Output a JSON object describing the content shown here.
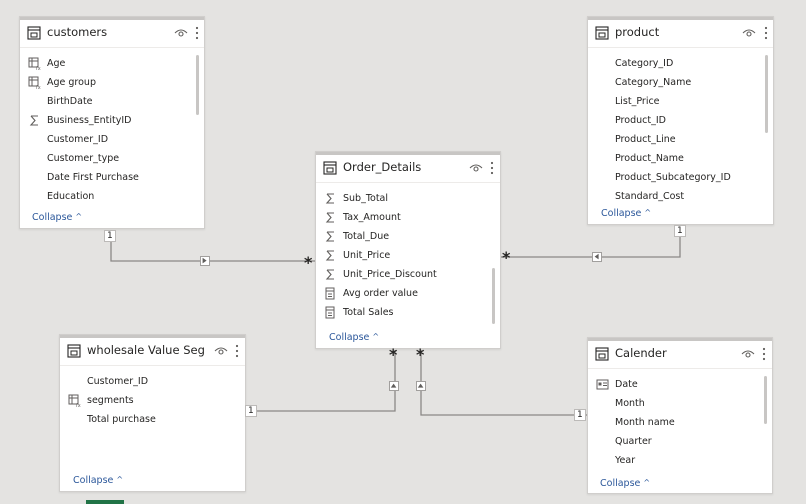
{
  "tables": {
    "customers": {
      "title": "customers",
      "fields": [
        {
          "label": "Age",
          "icon": "calculated-column-icon"
        },
        {
          "label": "Age group",
          "icon": "calculated-column-icon"
        },
        {
          "label": "BirthDate",
          "icon": ""
        },
        {
          "label": "Business_EntityID",
          "icon": "sigma-icon"
        },
        {
          "label": "Customer_ID",
          "icon": ""
        },
        {
          "label": "Customer_type",
          "icon": ""
        },
        {
          "label": "Date First Purchase",
          "icon": ""
        },
        {
          "label": "Education",
          "icon": ""
        }
      ],
      "collapse": "Collapse"
    },
    "product": {
      "title": "product",
      "fields": [
        {
          "label": "Category_ID",
          "icon": ""
        },
        {
          "label": "Category_Name",
          "icon": ""
        },
        {
          "label": "List_Price",
          "icon": ""
        },
        {
          "label": "Product_ID",
          "icon": ""
        },
        {
          "label": "Product_Line",
          "icon": ""
        },
        {
          "label": "Product_Name",
          "icon": ""
        },
        {
          "label": "Product_Subcategory_ID",
          "icon": ""
        },
        {
          "label": "Standard_Cost",
          "icon": ""
        }
      ],
      "collapse": "Collapse"
    },
    "order_details": {
      "title": "Order_Details",
      "fields": [
        {
          "label": "Sub_Total",
          "icon": "sigma-icon"
        },
        {
          "label": "Tax_Amount",
          "icon": "sigma-icon"
        },
        {
          "label": "Total_Due",
          "icon": "sigma-icon"
        },
        {
          "label": "Unit_Price",
          "icon": "sigma-icon"
        },
        {
          "label": "Unit_Price_Discount",
          "icon": "sigma-icon"
        },
        {
          "label": "Avg order value",
          "icon": "measure-icon"
        },
        {
          "label": "Total Sales",
          "icon": "measure-icon"
        }
      ],
      "collapse": "Collapse"
    },
    "wholesale": {
      "title": "wholesale Value Seg...",
      "fields": [
        {
          "label": "Customer_ID",
          "icon": ""
        },
        {
          "label": "segments",
          "icon": "calculated-column-icon"
        },
        {
          "label": "Total purchase",
          "icon": ""
        }
      ],
      "collapse": "Collapse"
    },
    "calender": {
      "title": "Calender",
      "fields": [
        {
          "label": "Date",
          "icon": "calendar-field-icon"
        },
        {
          "label": "Month",
          "icon": ""
        },
        {
          "label": "Month name",
          "icon": ""
        },
        {
          "label": "Quarter",
          "icon": ""
        },
        {
          "label": "Year",
          "icon": ""
        }
      ],
      "collapse": "Collapse"
    }
  },
  "relationships": {
    "customers_one": "1",
    "customers_many": "*",
    "product_one": "1",
    "product_many": "*",
    "wholesale_one": "1",
    "wholesale_many": "*",
    "calender_one": "1",
    "calender_many": "*"
  }
}
